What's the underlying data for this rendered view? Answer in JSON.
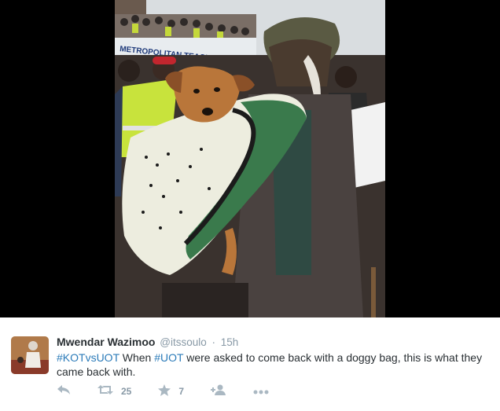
{
  "photo": {
    "sign_text": "METROPOLITAN TEACHERS SACCO LTD"
  },
  "tweet": {
    "author_name": "Mwendar Wazimoo",
    "author_handle": "@itssoulo",
    "separator": "·",
    "time": "15h",
    "text_parts": {
      "hashtag_1": "#KOTvsUOT",
      "text_1": " When ",
      "hashtag_2": "#UOT",
      "text_2": " were asked to come back with a doggy bag, this is what they came back with."
    }
  },
  "actions": {
    "reply_icon": "reply-icon",
    "retweet_icon": "retweet-icon",
    "retweet_count": "25",
    "favorite_icon": "star-icon",
    "favorite_count": "7",
    "follow_icon": "follow-icon",
    "more_icon": "more-icon"
  },
  "colors": {
    "link": "#2b7bb9",
    "muted": "#8899a6",
    "icon": "#aab8c2",
    "text": "#292f33",
    "media_bg": "#000000"
  }
}
